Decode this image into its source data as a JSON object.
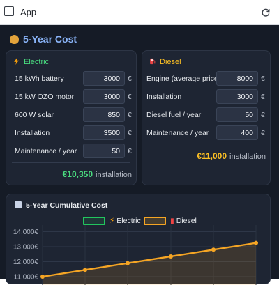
{
  "app": {
    "title": "App"
  },
  "page": {
    "title": "5-Year Cost"
  },
  "electric": {
    "title": "Electric",
    "rows": [
      {
        "label": "15 kWh battery",
        "value": "3000",
        "unit": "€"
      },
      {
        "label": "15 kW OZO motor",
        "value": "3000",
        "unit": "€"
      },
      {
        "label": "600 W solar",
        "value": "850",
        "unit": "€"
      },
      {
        "label": "Installation",
        "value": "3500",
        "unit": "€"
      },
      {
        "label": "Maintenance / year",
        "value": "50",
        "unit": "€"
      }
    ],
    "total": "€10,350",
    "total_suffix": "installation"
  },
  "diesel": {
    "title": "Diesel",
    "rows": [
      {
        "label": "Engine (average price)",
        "value": "8000",
        "unit": "€"
      },
      {
        "label": "Installation",
        "value": "3000",
        "unit": "€"
      },
      {
        "label": "Diesel fuel / year",
        "value": "50",
        "unit": "€"
      },
      {
        "label": "Maintenance / year",
        "value": "400",
        "unit": "€"
      }
    ],
    "total": "€11,000",
    "total_suffix": "installation"
  },
  "colors": {
    "electric": "#22c55e",
    "diesel": "#f5a524",
    "accent": "#8ab4f8"
  },
  "chart_data": {
    "type": "line",
    "title": "5-Year Cumulative Cost",
    "legend": [
      "Electric",
      "Diesel"
    ],
    "y_ticks": [
      "14,000€",
      "13,000€",
      "12,000€",
      "11,000€"
    ],
    "ylim": [
      11000,
      14000
    ],
    "series": [
      {
        "name": "Diesel",
        "values": [
          11000,
          11450,
          11900,
          12350,
          12800,
          13250
        ]
      }
    ]
  }
}
